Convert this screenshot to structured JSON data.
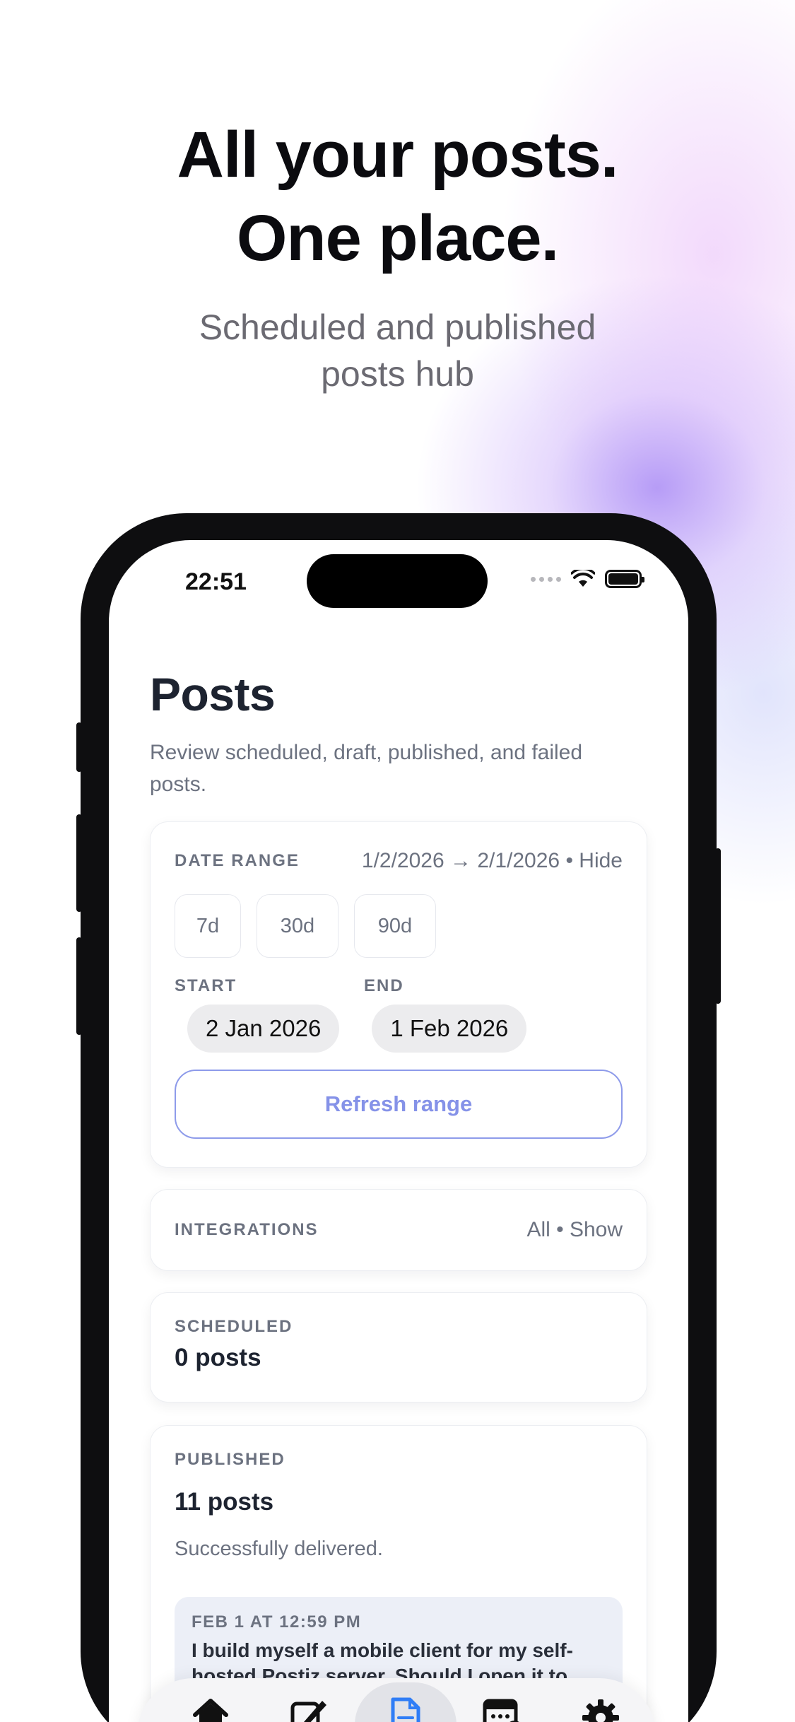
{
  "hero": {
    "title_line1": "All your posts.",
    "title_line2": "One place.",
    "subtitle_line1": "Scheduled and published",
    "subtitle_line2": "posts hub"
  },
  "status_bar": {
    "time": "22:51"
  },
  "page": {
    "title": "Posts",
    "description": "Review scheduled, draft, published, and failed posts."
  },
  "date_range": {
    "label": "DATE RANGE",
    "summary": "1/2/2026 → 2/1/2026 • Hide",
    "chips": [
      "7d",
      "30d",
      "90d"
    ],
    "start_label": "START",
    "end_label": "END",
    "start_value": "2 Jan 2026",
    "end_value": "1 Feb 2026",
    "refresh_label": "Refresh range"
  },
  "integrations": {
    "label": "INTEGRATIONS",
    "value": "All • Show"
  },
  "scheduled": {
    "label": "SCHEDULED",
    "count": "0 posts"
  },
  "published": {
    "label": "PUBLISHED",
    "count": "11 posts",
    "note": "Successfully delivered.",
    "items": [
      {
        "date": "FEB 1 AT 12:59 PM",
        "text": "I build myself a mobile client for my self-hosted Postiz server. Should I open it to"
      }
    ]
  },
  "tabbar": {
    "tabs": [
      "home-icon",
      "compose-icon",
      "posts-icon",
      "calendar-icon",
      "settings-icon"
    ],
    "active": "posts-icon",
    "accent": "#2f7df6"
  }
}
